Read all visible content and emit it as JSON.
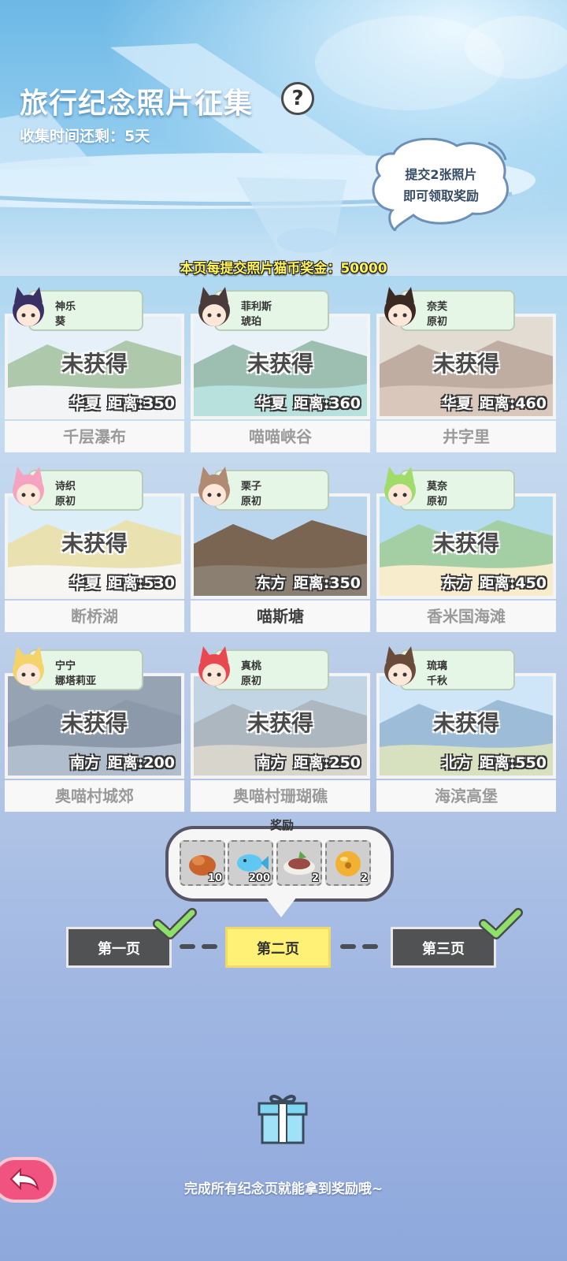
{
  "header": {
    "title": "旅行纪念照片征集",
    "help_icon": "?",
    "time_left": "收集时间还剩：5天"
  },
  "bubble": {
    "line1": "提交2张照片",
    "line2": "即可领取奖励"
  },
  "bonus_text": "本页每提交照片猫币奖金：50000",
  "cards": [
    {
      "name": "千层瀑布",
      "status": "未获得",
      "region": "华夏",
      "distance": "距离:350",
      "char1": "神乐",
      "char2": "葵"
    },
    {
      "name": "喵喵峡谷",
      "status": "未获得",
      "region": "华夏",
      "distance": "距离:360",
      "char1": "菲利斯",
      "char2": "琥珀"
    },
    {
      "name": "井字里",
      "status": "未获得",
      "region": "华夏",
      "distance": "距离:460",
      "char1": "奈芙",
      "char2": "原初"
    },
    {
      "name": "断桥湖",
      "status": "未获得",
      "region": "华夏",
      "distance": "距离:530",
      "char1": "诗织",
      "char2": "原初"
    },
    {
      "name": "喵斯塘",
      "status": "",
      "region": "东方",
      "distance": "距离:350",
      "char1": "栗子",
      "char2": "原初"
    },
    {
      "name": "香米国海滩",
      "status": "未获得",
      "region": "东方",
      "distance": "距离:450",
      "char1": "莫奈",
      "char2": "原初"
    },
    {
      "name": "奥喵村城郊",
      "status": "未获得",
      "region": "南方",
      "distance": "距离:200",
      "char1": "宁宁",
      "char2": "娜塔莉亚"
    },
    {
      "name": "奥喵村珊瑚礁",
      "status": "未获得",
      "region": "南方",
      "distance": "距离:250",
      "char1": "真桃",
      "char2": "原初"
    },
    {
      "name": "海滨高堡",
      "status": "未获得",
      "region": "北方",
      "distance": "距离:550",
      "char1": "琉璃",
      "char2": "千秋"
    }
  ],
  "reward": {
    "label": "奖励",
    "items": [
      {
        "icon": "fried-food-icon",
        "count": "10"
      },
      {
        "icon": "blue-fish-icon",
        "count": "200"
      },
      {
        "icon": "cooked-dish-icon",
        "count": "2"
      },
      {
        "icon": "golden-bell-icon",
        "count": "2"
      }
    ]
  },
  "pages": [
    {
      "label": "第一页",
      "done": true
    },
    {
      "label": "第二页",
      "current": true
    },
    {
      "label": "第三页",
      "done": true
    }
  ],
  "footer_hint": "完成所有纪念页就能拿到奖励哦~",
  "colors": {
    "accent_yellow": "#fff176",
    "check_green": "#8ee06a",
    "back_pink": "#f0537f",
    "tag_green": "#e6f6e6"
  }
}
